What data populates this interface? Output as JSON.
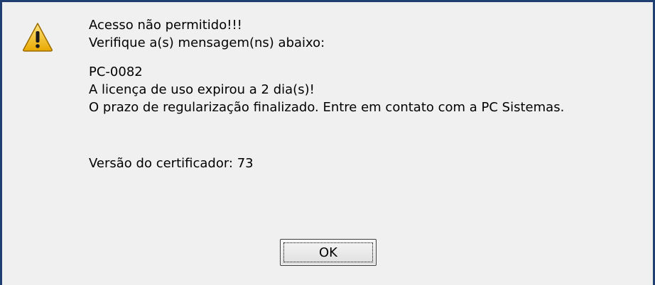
{
  "dialog": {
    "icon": "warning-icon",
    "lines": [
      "Acesso não permitido!!!",
      "Verifique a(s) mensagem(ns) abaixo:",
      "PC-0082",
      "A licença de uso expirou a 2 dia(s)!",
      "O prazo de regularização finalizado. Entre em contato com a PC Sistemas.",
      "Versão do certificador: 73"
    ],
    "ok_label": "OK"
  },
  "colors": {
    "frame": "#1f3f73",
    "background": "#f0f0f0",
    "warning_fill": "#f5c518"
  }
}
